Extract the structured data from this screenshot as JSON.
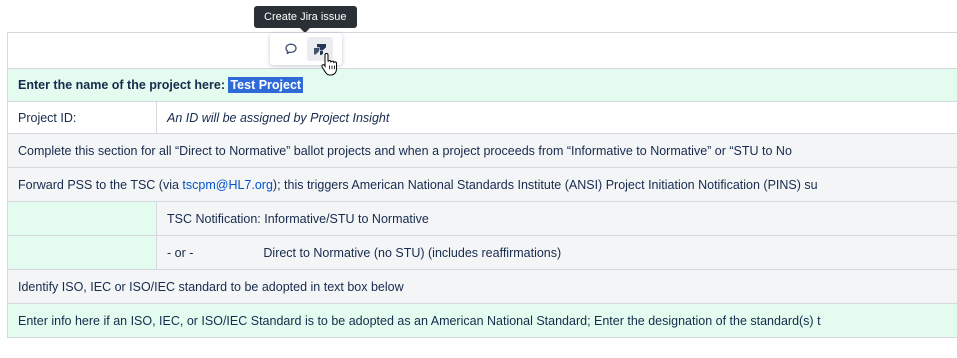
{
  "tooltip": {
    "text": "Create Jira issue"
  },
  "toolbar": {
    "comment_icon": "comment-icon",
    "jira_icon": "jira-icon"
  },
  "rows": {
    "project_name": {
      "label": "Enter the name of the project here:",
      "value": "Test Project"
    },
    "project_id": {
      "label": "Project ID:",
      "value": "An ID will be assigned by Project Insight"
    },
    "complete_section": "Complete this section for all “Direct to Normative” ballot projects and when a project proceeds from “Informative to Normative” or “STU to No",
    "forward_pss": {
      "before": "Forward PSS to the TSC (via ",
      "email": "tscpm@HL7.org",
      "after": "); this triggers American National Standards Institute (ANSI) Project Initiation Notification (PINS) su"
    },
    "tsc_notification": "TSC Notification:  Informative/STU to Normative",
    "direct": {
      "prefix": "- or -",
      "text": "Direct to Normative (no STU) (includes reaffirmations)"
    },
    "identify_iso": "Identify ISO, IEC or ISO/IEC standard to be adopted in text box below",
    "enter_info": "Enter info here if an ISO, IEC, or ISO/IEC Standard is to be adopted as an American National Standard; Enter the designation of the standard(s) t"
  }
}
